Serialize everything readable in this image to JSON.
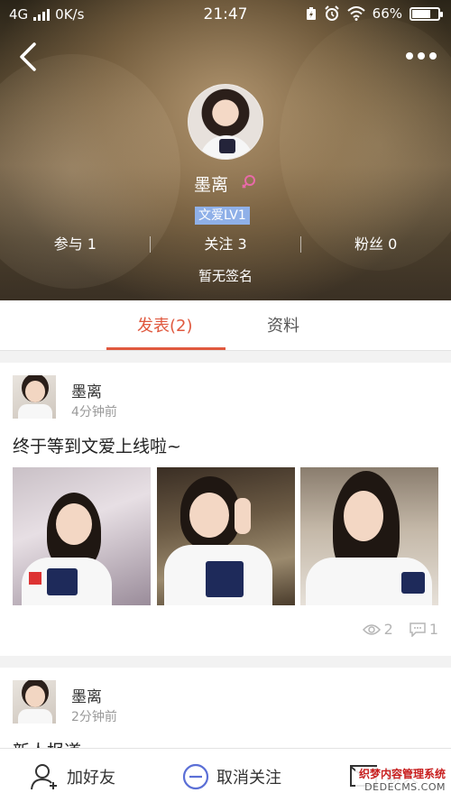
{
  "status_bar": {
    "network": "4G",
    "speed": "0K/s",
    "time": "21:47",
    "battery": "66%",
    "battery_level": 0.66
  },
  "profile": {
    "name": "墨离",
    "gender": "female",
    "level": "文爱LV1",
    "stats": [
      {
        "label": "参与 1"
      },
      {
        "label": "关注 3"
      },
      {
        "label": "粉丝 0"
      }
    ],
    "signature": "暂无签名"
  },
  "tabs": {
    "posts": "发表(2)",
    "info": "资料"
  },
  "posts": [
    {
      "author": "墨离",
      "time": "4分钟前",
      "text": "终于等到文爱上线啦~",
      "views": "2",
      "comments": "1"
    },
    {
      "author": "墨离",
      "time": "2分钟前",
      "text": "新人报道"
    }
  ],
  "bottom_bar": {
    "add_friend": "加好友",
    "unfollow": "取消关注",
    "chat": "聊天"
  },
  "watermark": {
    "line1": "织梦内容管理系统",
    "line2": "DEDECMS.COM"
  },
  "colors": {
    "accent": "#e0593f",
    "level_badge": "#8fb0e8",
    "gender_icon": "#e86aa8",
    "unfollow_icon": "#5b6fd6"
  }
}
